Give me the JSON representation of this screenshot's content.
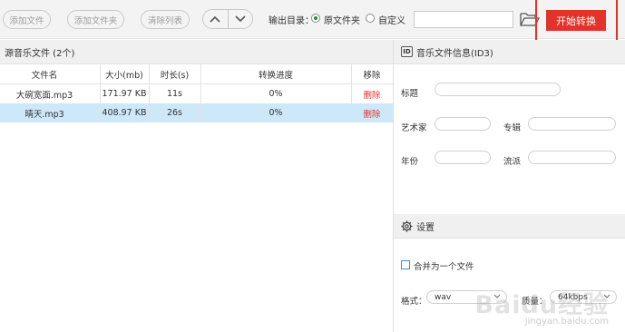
{
  "toolbar": {
    "add_file": "添加文件",
    "add_folder": "添加文件夹",
    "clear_list": "清除列表",
    "output_label": "输出目录：",
    "radio_original": "原文件夹",
    "radio_custom": "自定义",
    "output_path": "",
    "start_label": "开始转换"
  },
  "file_list": {
    "title": "源音乐文件 (2个)",
    "columns": {
      "name": "文件名",
      "size": "大小(mb)",
      "duration": "时长(s)",
      "progress": "转换进度",
      "remove": "移除"
    },
    "rows": [
      {
        "name": "大碗宽面.mp3",
        "size": "171.97 KB",
        "duration": "11s",
        "progress": "0%",
        "remove": "删除"
      },
      {
        "name": "晴天.mp3",
        "size": "408.97 KB",
        "duration": "26s",
        "progress": "0%",
        "remove": "删除"
      }
    ]
  },
  "id3": {
    "title": "音乐文件信息(ID3)",
    "id_badge": "ID",
    "fields": {
      "title": "标题",
      "artist": "艺术家",
      "album": "专辑",
      "year": "年份",
      "genre": "流派"
    }
  },
  "settings": {
    "title": "设置",
    "merge_label": "合并为一个文件",
    "format_label": "格式：",
    "format_value": "wav",
    "quality_label": "质量：",
    "quality_value": "64kbps"
  },
  "watermark": {
    "brand": "Baidu经验",
    "url": "jingyan.baidu.com"
  },
  "colors": {
    "accent_red": "#e3322b",
    "selection_blue": "#cde8f8",
    "radio_green": "#2a8a2a"
  }
}
